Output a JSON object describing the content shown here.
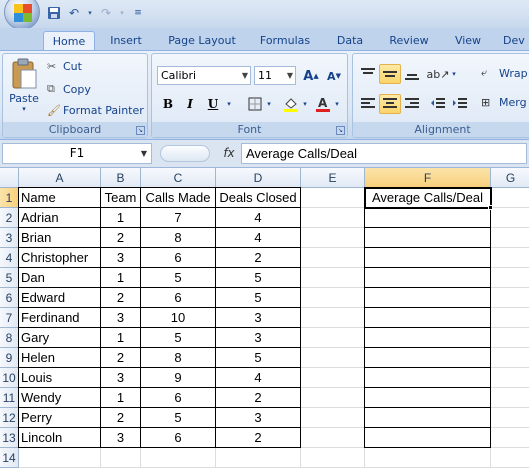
{
  "quick_access": {
    "save_icon": "save-icon",
    "undo_icon": "undo-icon",
    "redo_icon": "redo-icon",
    "customize_icon": "customize-qat-icon"
  },
  "tabs": [
    {
      "label": "Home",
      "active": true
    },
    {
      "label": "Insert"
    },
    {
      "label": "Page Layout"
    },
    {
      "label": "Formulas"
    },
    {
      "label": "Data"
    },
    {
      "label": "Review"
    },
    {
      "label": "View"
    },
    {
      "label": "Dev"
    }
  ],
  "clipboard": {
    "paste": "Paste",
    "cut": "Cut",
    "copy": "Copy",
    "format_painter": "Format Painter",
    "group_label": "Clipboard"
  },
  "font": {
    "name": "Calibri",
    "size": "11",
    "group_label": "Font",
    "bold": "B",
    "italic": "I",
    "underline": "U"
  },
  "alignment": {
    "wrap": "Wrap",
    "merge": "Merg",
    "group_label": "Alignment"
  },
  "formula_bar": {
    "name_box": "F1",
    "fx": "fx",
    "formula": "Average Calls/Deal"
  },
  "columns": [
    "A",
    "B",
    "C",
    "D",
    "E",
    "F",
    "G"
  ],
  "active_column": "F",
  "row_numbers": [
    "1",
    "2",
    "3",
    "4",
    "5",
    "6",
    "7",
    "8",
    "9",
    "10",
    "11",
    "12",
    "13",
    "14"
  ],
  "header_row": {
    "A": "Name",
    "B": "Team",
    "C": "Calls Made",
    "D": "Deals Closed",
    "F": "Average Calls/Deal"
  },
  "rows": [
    {
      "name": "Adrian",
      "team": "1",
      "calls": "7",
      "deals": "4"
    },
    {
      "name": "Brian",
      "team": "2",
      "calls": "8",
      "deals": "4"
    },
    {
      "name": "Christopher",
      "team": "3",
      "calls": "6",
      "deals": "2"
    },
    {
      "name": "Dan",
      "team": "1",
      "calls": "5",
      "deals": "5"
    },
    {
      "name": "Edward",
      "team": "2",
      "calls": "6",
      "deals": "5"
    },
    {
      "name": "Ferdinand",
      "team": "3",
      "calls": "10",
      "deals": "3"
    },
    {
      "name": "Gary",
      "team": "1",
      "calls": "5",
      "deals": "3"
    },
    {
      "name": "Helen",
      "team": "2",
      "calls": "8",
      "deals": "5"
    },
    {
      "name": "Louis",
      "team": "3",
      "calls": "9",
      "deals": "4"
    },
    {
      "name": "Wendy",
      "team": "1",
      "calls": "6",
      "deals": "2"
    },
    {
      "name": "Perry",
      "team": "2",
      "calls": "5",
      "deals": "3"
    },
    {
      "name": "Lincoln",
      "team": "3",
      "calls": "6",
      "deals": "2"
    }
  ]
}
